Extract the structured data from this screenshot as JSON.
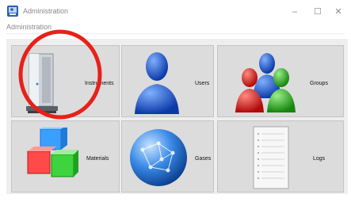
{
  "window": {
    "title": "Administration",
    "minimize": "–",
    "maximize": "☐",
    "close": "✕"
  },
  "menu": {
    "label": "Administration"
  },
  "tiles": [
    {
      "label": "Instruments",
      "icon": "server-tower-icon"
    },
    {
      "label": "Users",
      "icon": "user-silhouette-icon"
    },
    {
      "label": "Groups",
      "icon": "group-of-users-icon"
    },
    {
      "label": "Materials",
      "icon": "stacked-cubes-icon"
    },
    {
      "label": "Gases",
      "icon": "network-globe-icon"
    },
    {
      "label": "Logs",
      "icon": "document-page-icon"
    }
  ],
  "annotation": {
    "shape": "circle",
    "color": "#e8201a"
  }
}
